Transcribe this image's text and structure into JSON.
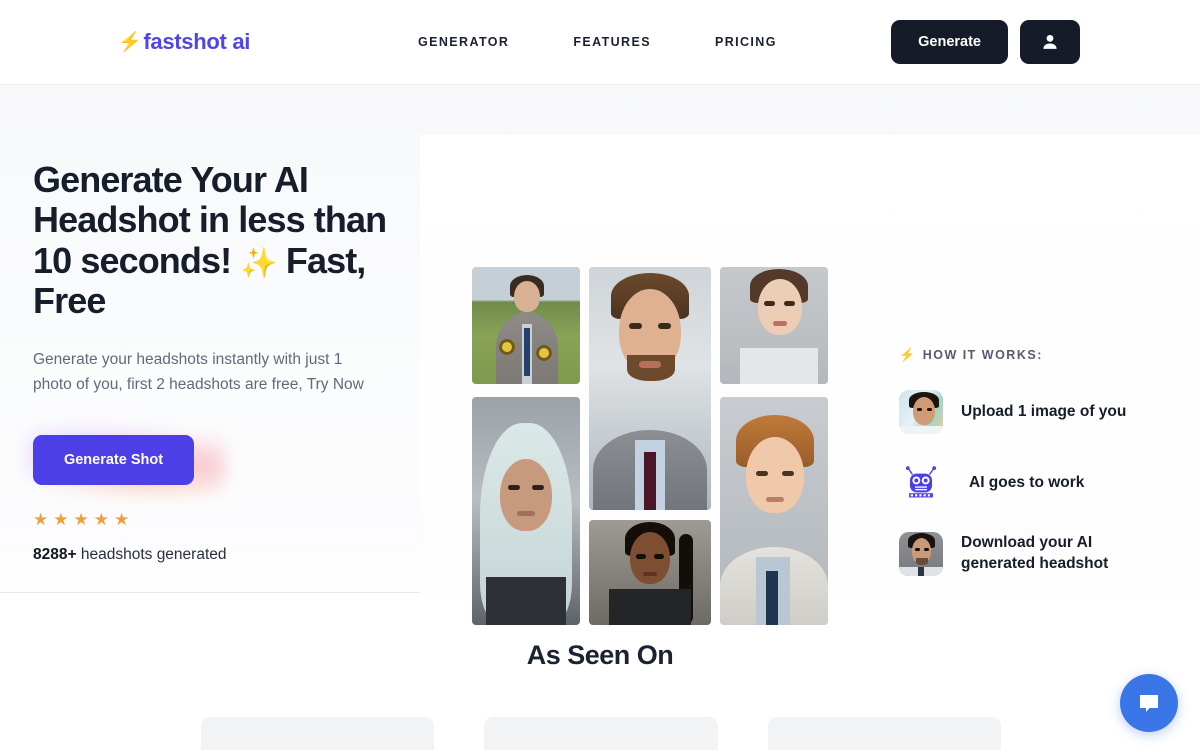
{
  "header": {
    "logo_bolt": "⚡",
    "logo_text": "fastshot ai",
    "nav": [
      {
        "label": "GENERATOR"
      },
      {
        "label": "FEATURES"
      },
      {
        "label": "PRICING"
      }
    ],
    "generate_button": "Generate",
    "account_icon": "user-avatar-icon"
  },
  "hero": {
    "headline_line1": "Generate Your AI",
    "headline_line2": "Headshot in less than",
    "headline_line3_a": "10 seconds!",
    "headline_sparkle": "✨",
    "headline_line3_b": "Fast,",
    "headline_line4": "Free",
    "subhead_line1": "Generate your headshots instantly with just 1",
    "subhead_line2": "photo of you, first 2 headshots are free, Try Now",
    "cta_label": "Generate Shot",
    "stars": "★★★★★",
    "star_count": 5,
    "count_number": "8288+",
    "count_text": " headshots generated",
    "accent_color": "#4c3fe6",
    "star_color": "#eda13a",
    "dark_color": "#151b28"
  },
  "collage": {
    "photos": [
      {
        "name": "man-in-suit-sunflower-field",
        "column": "left",
        "slot": 1
      },
      {
        "name": "woman-in-hijab-portrait",
        "column": "left",
        "slot": 2
      },
      {
        "name": "bearded-man-grey-suit-burgundy-tie",
        "column": "middle",
        "slot": 1
      },
      {
        "name": "black-woman-braids-portrait",
        "column": "middle",
        "slot": 2
      },
      {
        "name": "asian-woman-white-blazer",
        "column": "right",
        "slot": 1
      },
      {
        "name": "red-haired-man-light-suit",
        "column": "right",
        "slot": 2
      }
    ]
  },
  "how_it_works": {
    "bolt": "⚡",
    "title": "HOW IT WORKS:",
    "steps": [
      {
        "icon": "photo-thumbnail-young-man",
        "label": "Upload 1 image of you"
      },
      {
        "icon": "robot-icon",
        "glyph": "🤖",
        "label": "AI goes to work"
      },
      {
        "icon": "photo-thumbnail-generated-headshot",
        "label_line1": "Download your AI",
        "label_line2": "generated headshot"
      }
    ]
  },
  "as_seen_on": {
    "title": "As Seen On",
    "cards": [
      {
        "name": "logo-placeholder-1"
      },
      {
        "name": "logo-placeholder-2"
      },
      {
        "name": "logo-placeholder-3"
      }
    ]
  },
  "chat": {
    "icon": "chat-bubble-icon",
    "color": "#3b76e8"
  }
}
